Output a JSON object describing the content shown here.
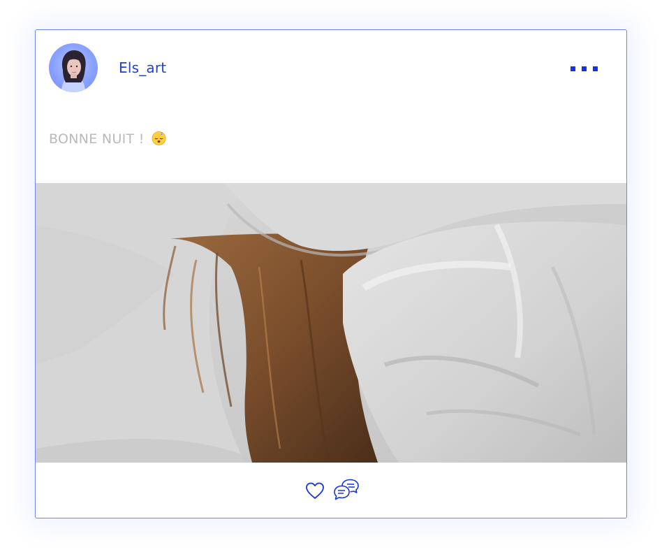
{
  "post": {
    "author": {
      "username": "Els_art",
      "avatar_icon": "profile-photo-avatar"
    },
    "menu_icon": "more-dots-icon",
    "caption": "BONNE NUIT !",
    "caption_emoji": "sleeping-face-emoji",
    "image_icon": "photo-hair-on-white-bedsheets",
    "actions": {
      "like_icon": "heart-outline-icon",
      "comment_icon": "chat-bubbles-icon"
    }
  },
  "colors": {
    "accent": "#1432e6",
    "username": "#1d3fe0",
    "caption_text": "#b9b9b9",
    "card_border": "#6f86e8",
    "background": "#ffffff"
  }
}
